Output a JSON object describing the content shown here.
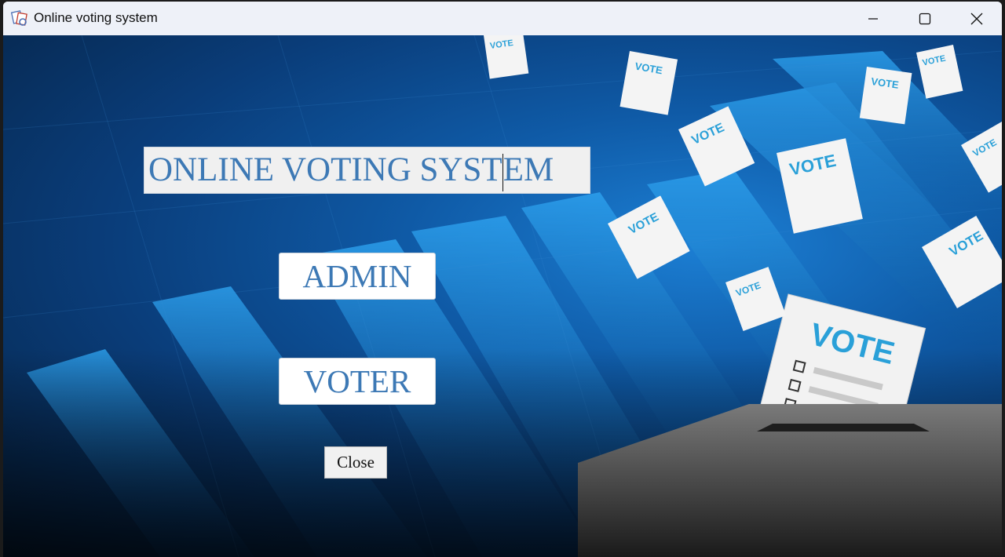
{
  "window": {
    "title": "Online voting system"
  },
  "main": {
    "heading_left": "ONLINE VOTING SYST",
    "heading_right": "EM",
    "admin_label": "ADMIN",
    "voter_label": "VOTER",
    "close_label": "Close"
  },
  "art": {
    "ballot_text": "VOTE"
  },
  "icons": {
    "app": "voting-app-icon",
    "minimize": "minimize-icon",
    "maximize": "maximize-icon",
    "close": "close-icon"
  }
}
